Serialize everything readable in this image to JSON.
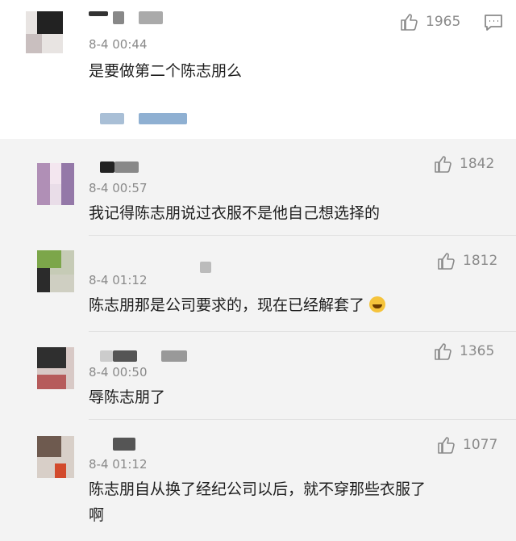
{
  "comments": [
    {
      "timestamp": "8-4 00:44",
      "text": "是要做第二个陈志朋么",
      "likes": "1965"
    },
    {
      "timestamp": "8-4 00:57",
      "text": "我记得陈志朋说过衣服不是他自己想选择的",
      "likes": "1842"
    },
    {
      "timestamp": "8-4 01:12",
      "text": "陈志朋那是公司要求的，现在已经解套了",
      "likes": "1812",
      "emoji": "laughing-emoji-icon"
    },
    {
      "timestamp": "8-4 00:50",
      "text": "辱陈志朋了",
      "likes": "1365"
    },
    {
      "timestamp": "8-4 01:12",
      "text": "陈志朋自从换了经纪公司以后，就不穿那些衣服了",
      "text_line2": "啊",
      "likes": "1077"
    }
  ],
  "icons": {
    "like": "thumbs-up-icon",
    "reply": "comment-icon"
  },
  "colors": {
    "background": "#f3f3f3",
    "top_card": "#ffffff",
    "meta_text": "#8a8a8a",
    "body_text": "#1e1e1e"
  }
}
